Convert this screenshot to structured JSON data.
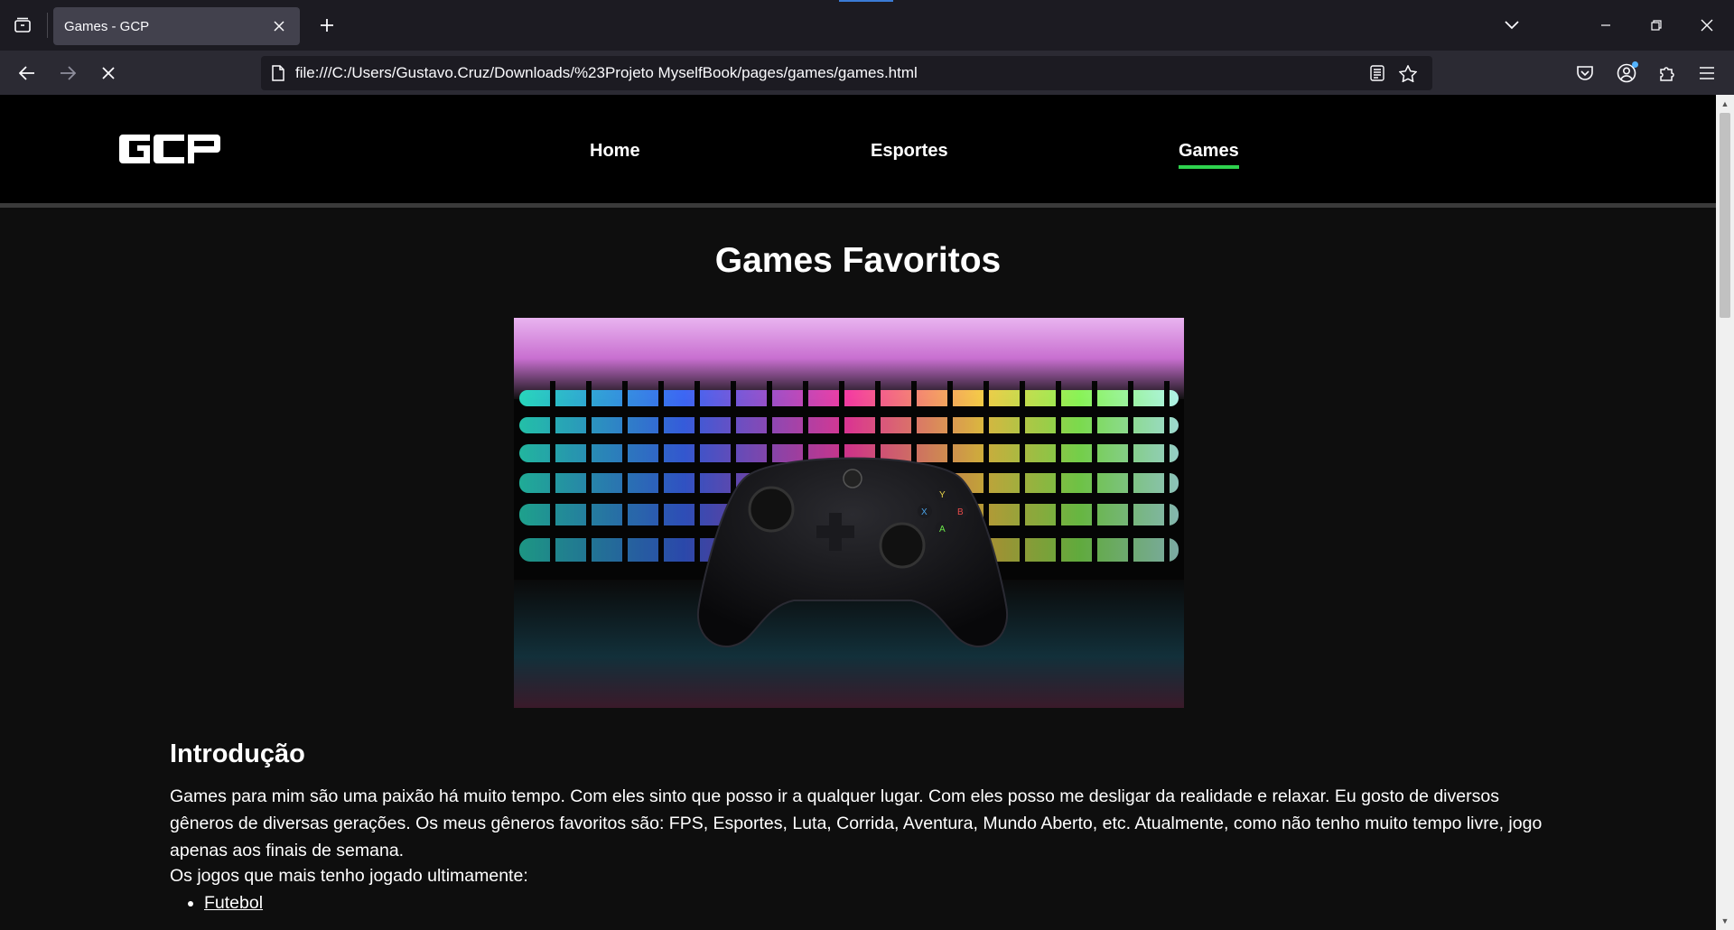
{
  "browser": {
    "tab_title": "Games - GCP",
    "url": "file:///C:/Users/Gustavo.Cruz/Downloads/%23Projeto MyselfBook/pages/games/games.html"
  },
  "site": {
    "logo_text": "GCP",
    "menu": [
      {
        "label": "Home",
        "active": false
      },
      {
        "label": "Esportes",
        "active": false
      },
      {
        "label": "Games",
        "active": true
      }
    ],
    "accent_color": "#2ed34e"
  },
  "main": {
    "title": "Games Favoritos",
    "hero_alt": "Xbox controller in front of RGB keyboard",
    "intro_heading": "Introdução",
    "intro_paragraph": "Games para mim são uma paixão há muito tempo. Com eles sinto que posso ir a qualquer lugar. Com eles posso me desligar da realidade e relaxar. Eu gosto de diversos gêneros de diversas gerações. Os meus gêneros favoritos são: FPS, Esportes, Luta, Corrida, Aventura, Mundo Aberto, etc. Atualmente, como não tenho muito tempo livre, jogo apenas aos finais de semana.",
    "games_intro": "Os jogos que mais tenho jogado ultimamente:",
    "games": [
      "Futebol"
    ]
  }
}
